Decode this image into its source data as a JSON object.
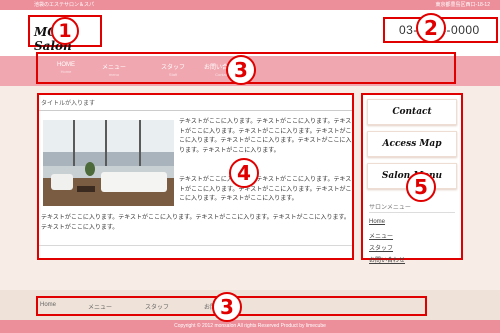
{
  "topbar": {
    "left_text": "池袋のエステサロン＆スパ",
    "right_text": "東京都豊島区西口-18-12"
  },
  "header": {
    "logo_text": "MON Salon",
    "phone_text": "03-1234-0000"
  },
  "callouts": [
    "1",
    "2",
    "3",
    "4",
    "5",
    "3"
  ],
  "nav": {
    "items": [
      {
        "label": "HOME",
        "sub": "Home"
      },
      {
        "label": "メニュー",
        "sub": "menu"
      },
      {
        "label": "スタッフ",
        "sub": "Staff"
      },
      {
        "label": "お問い合わせ",
        "sub": "Contact"
      }
    ]
  },
  "main": {
    "title": "タイトルが入ります",
    "para1": "テキストがここに入ります。テキストがここに入ります。テキストがここに入ります。テキストがここに入ります。テキストがここに入ります。テキストがここに入ります。テキストがここに入ります。テキストがここに入ります。",
    "para2": "テキストがここに入ります。テキストがここに入ります。テキストがここに入ります。テキストがここに入ります。テキストがここに入ります。テキストがここに入ります。",
    "para3": "テキストがここに入ります。テキストがここに入ります。テキストがここに入ります。テキストがここに入ります。テキストがここに入ります。"
  },
  "sidebar": {
    "buttons": [
      "Contact",
      "Access Map",
      "Salon Menu"
    ],
    "heading": "サロンメニュー",
    "links": [
      "Home",
      "メニュー",
      "スタッフ",
      "お問い合わせ"
    ]
  },
  "footer": {
    "nav": [
      "Home",
      "メニュー",
      "スタッフ",
      "お問い合わせ"
    ],
    "copyright": "Copyright © 2012 monsalon All rights Reserved Product by limecube"
  },
  "colors": {
    "pink": "#ec8f9b",
    "nav_pink": "#f0a7b0",
    "callout_red": "#e00000",
    "cream": "#f7ede6"
  }
}
